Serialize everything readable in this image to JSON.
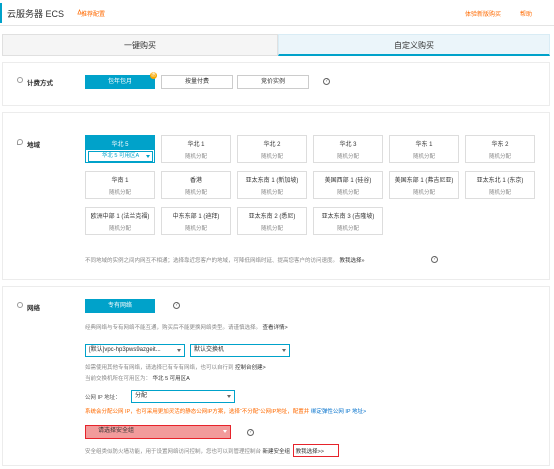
{
  "header": {
    "title": "云服务器 ECS",
    "recommend_label": "推荐配置",
    "link_experience": "体验新版购买",
    "link_help": "帮助"
  },
  "tabs": [
    {
      "label": "一键购买",
      "active": false
    },
    {
      "label": "自定义购买",
      "active": true
    }
  ],
  "billing": {
    "label": "计费方式",
    "options": [
      {
        "label": "包年包月",
        "active": true,
        "badge": "惠"
      },
      {
        "label": "按量付费",
        "active": false
      },
      {
        "label": "竞价实例",
        "active": false
      }
    ]
  },
  "region": {
    "label": "地域",
    "cards": [
      {
        "name": "华北 5",
        "zone": "华北 5 可用区A",
        "selected": true
      },
      {
        "name": "华北 1",
        "zone": "随机分配"
      },
      {
        "name": "华北 2",
        "zone": "随机分配"
      },
      {
        "name": "华北 3",
        "zone": "随机分配"
      },
      {
        "name": "华东 1",
        "zone": "随机分配"
      },
      {
        "name": "华东 2",
        "zone": "随机分配"
      },
      {
        "name": "华南 1",
        "zone": "随机分配"
      },
      {
        "name": "香港",
        "zone": "随机分配"
      },
      {
        "name": "亚太东南 1 (新加坡)",
        "zone": "随机分配"
      },
      {
        "name": "美国西部 1 (硅谷)",
        "zone": "随机分配"
      },
      {
        "name": "美国东部 1 (弗吉尼亚)",
        "zone": "随机分配"
      },
      {
        "name": "亚太东北 1 (东京)",
        "zone": "随机分配"
      },
      {
        "name": "欧洲中部 1 (法兰克福)",
        "zone": "随机分配"
      },
      {
        "name": "中东东部 1 (迪拜)",
        "zone": "随机分配"
      },
      {
        "name": "亚太东南 2 (悉尼)",
        "zone": "随机分配"
      },
      {
        "name": "亚太东南 3 (吉隆坡)",
        "zone": "随机分配"
      }
    ],
    "note": "不同地域的实例之间内网互不相通；选择靠近您客户的地域，可降低网络时延、提高您客户的访问速度。",
    "note_link": "教我选择»"
  },
  "network": {
    "label": "网络",
    "type_button": "专有网络",
    "note_1": "经典网络与专有网络不能互通，购买后不能更换网络类型。请谨慎选择。",
    "note_1_link": "查看详情>",
    "vpc_select": "[默认]vpc-hp3pws9azgeit...",
    "vswitch_select": "默认交换机",
    "note_2": "如需使用其他专有网络，请选择已有专有网络，也可以自行到",
    "note_2_link": "控制台创建>",
    "note_3_prefix": "当前交换机所在可用区为：",
    "note_3_value": "华北 5 可用区A",
    "public_ip_label": "公网 IP 地址：",
    "public_ip_select": "分配",
    "public_ip_note": "系统会分配公网 IP，也可采用更加灵活的静态公网IP方案，选择“不分配”公网IP地址，配置并",
    "public_ip_link": "绑定弹性公网 IP 地址>",
    "security_select": "请选择安全组",
    "security_note": "安全组类似防火墙功能，用于设置网络访问控制，您也可以到管理控制台",
    "security_new": "新建安全组",
    "security_learn": "教我选择>>"
  },
  "colors": {
    "accent": "#00a2ca",
    "orange": "#ff6a00",
    "highlight_red": "#e6232b"
  }
}
